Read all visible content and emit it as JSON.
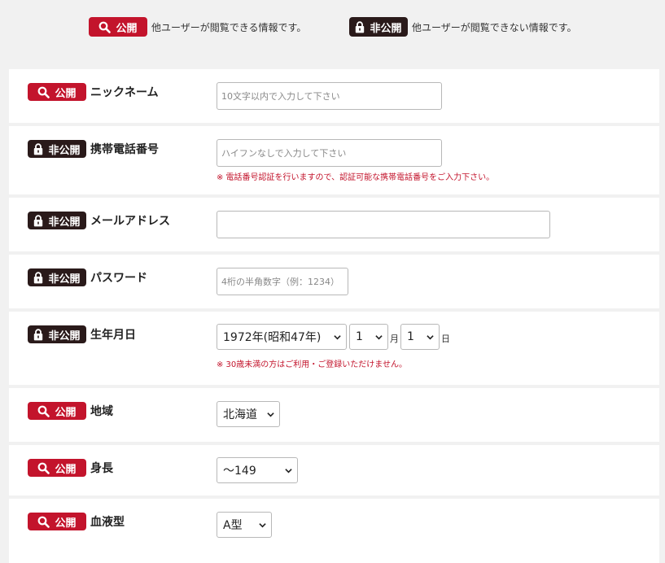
{
  "legend": {
    "public_badge": "公開",
    "public_text": "他ユーザーが閲覧できる情報です。",
    "private_badge": "非公開",
    "private_text": "他ユーザーが閲覧できない情報です。"
  },
  "rows": {
    "nickname": {
      "badge": "公開",
      "label": "ニックネーム",
      "placeholder": "10文字以内で入力して下さい"
    },
    "phone": {
      "badge": "非公開",
      "label": "携帯電話番号",
      "placeholder": "ハイフンなしで入力して下さい",
      "note": "※ 電話番号認証を行いますので、認証可能な携帯電話番号をご入力下さい。"
    },
    "email": {
      "badge": "非公開",
      "label": "メールアドレス",
      "value": ""
    },
    "password": {
      "badge": "非公開",
      "label": "パスワード",
      "placeholder": "4桁の半角数字（例：1234）"
    },
    "birthday": {
      "badge": "非公開",
      "label": "生年月日",
      "year": "1972年(昭和47年)",
      "month": "1",
      "month_unit": "月",
      "day": "1",
      "day_unit": "日",
      "note": "※ 30歳未満の方はご利用・ご登録いただけません。"
    },
    "region": {
      "badge": "公開",
      "label": "地域",
      "value": "北海道"
    },
    "height": {
      "badge": "公開",
      "label": "身長",
      "value": "〜149"
    },
    "blood": {
      "badge": "公開",
      "label": "血液型",
      "value": "A型"
    }
  },
  "colors": {
    "public": "#c3142c",
    "private": "#2a1a1a",
    "note": "#c3142c"
  }
}
